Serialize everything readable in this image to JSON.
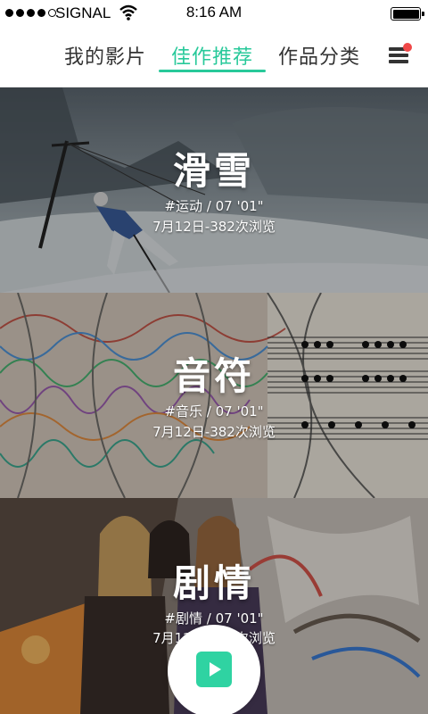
{
  "status_bar": {
    "carrier": "SIGNAL",
    "time": "8:16 AM",
    "signal_dots_filled": 4,
    "signal_dots_total": 5,
    "battery_level": 1.0
  },
  "nav": {
    "tabs": [
      {
        "label": "我的影片",
        "active": false
      },
      {
        "label": "佳作推荐",
        "active": true
      },
      {
        "label": "作品分类",
        "active": false
      }
    ],
    "accent_color": "#28c99a",
    "menu_icon": "hamburger-menu-icon",
    "notification_dot_color": "#f04848"
  },
  "cards": [
    {
      "title": "滑雪",
      "tag": "#运动",
      "duration": "07 '01\"",
      "date": "7月12日",
      "views": "382次浏览"
    },
    {
      "title": "音符",
      "tag": "#音乐",
      "duration": "07 '01\"",
      "date": "7月12日",
      "views": "382次浏览"
    },
    {
      "title": "剧情",
      "tag": "#剧情",
      "duration": "07 '01\"",
      "date": "7月12日",
      "views": "382次浏览"
    }
  ],
  "play_button": {
    "icon": "play-icon",
    "color": "#2fd3a2"
  }
}
